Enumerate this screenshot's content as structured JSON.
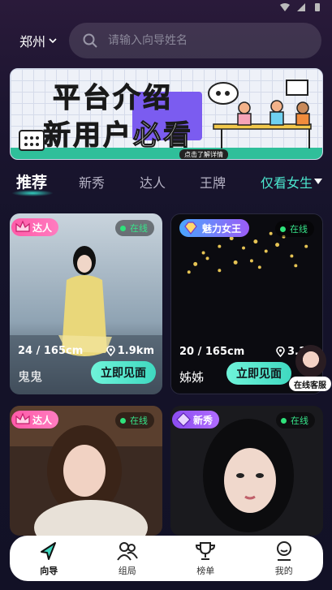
{
  "header": {
    "city": "郑州",
    "search_placeholder": "请输入向导姓名"
  },
  "banner": {
    "line1": "平台介绍",
    "line2_a": "新用户",
    "line2_b": "必看",
    "cta": "点击了解详情"
  },
  "tabs": [
    {
      "label": "推荐",
      "active": true
    },
    {
      "label": "新秀",
      "active": false
    },
    {
      "label": "达人",
      "active": false
    },
    {
      "label": "王牌",
      "active": false
    }
  ],
  "filter_label": "仅看女生",
  "cards": [
    {
      "badge": "达人",
      "online": "在线",
      "age_height": "24 / 165cm",
      "distance": "1.9km",
      "name": "鬼鬼",
      "action": "立即见面"
    },
    {
      "badge": "魅力女王",
      "online": "在线",
      "age_height": "20 / 165cm",
      "distance": "3.1",
      "name": "姊姊",
      "action": "立即见面"
    },
    {
      "badge": "达人",
      "online": "在线"
    },
    {
      "badge": "新秀",
      "online": "在线"
    }
  ],
  "customer_service": "在线客服",
  "nav": [
    {
      "label": "向导",
      "icon": "guide-arrow-icon",
      "active": true
    },
    {
      "label": "组局",
      "icon": "group-icon",
      "active": false
    },
    {
      "label": "榜单",
      "icon": "trophy-icon",
      "active": false
    },
    {
      "label": "我的",
      "icon": "profile-icon",
      "active": false
    }
  ],
  "colors": {
    "accent": "#3fd9c0",
    "online": "#2fe27b",
    "badge_pink": "#f0479a",
    "badge_purple": "#9b5cf6"
  }
}
